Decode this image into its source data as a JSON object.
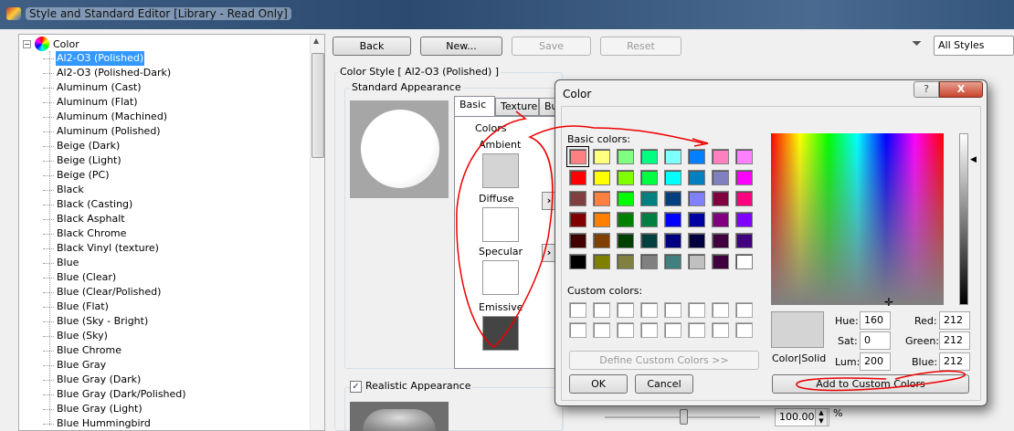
{
  "window": {
    "title": "Style and Standard Editor [Library - Read Only]"
  },
  "tree": {
    "root": "Color",
    "items": [
      "Al2-O3 (Polished)",
      "Al2-O3 (Polished-Dark)",
      "Aluminum (Cast)",
      "Aluminum (Flat)",
      "Aluminum (Machined)",
      "Aluminum (Polished)",
      "Beige (Dark)",
      "Beige (Light)",
      "Beige (PC)",
      "Black",
      "Black (Casting)",
      "Black Asphalt",
      "Black Chrome",
      "Black Vinyl (texture)",
      "Blue",
      "Blue (Clear)",
      "Blue (Clear/Polished)",
      "Blue (Flat)",
      "Blue (Sky - Bright)",
      "Blue (Sky)",
      "Blue Chrome",
      "Blue Gray",
      "Blue Gray (Dark)",
      "Blue Gray (Dark/Polished)",
      "Blue Gray (Light)",
      "Blue Hummingbird"
    ],
    "selected": 0
  },
  "toolbar": {
    "back": "Back",
    "new": "New...",
    "save": "Save",
    "reset": "Reset",
    "filter": "All Styles"
  },
  "style": {
    "header": "Color Style [ Al2-O3 (Polished) ]",
    "standard": "Standard Appearance",
    "tabs": [
      "Basic",
      "Texture",
      "Bu"
    ],
    "colors_label": "Colors",
    "ambient": "Ambient",
    "diffuse": "Diffuse",
    "specular": "Specular",
    "emissive": "Emissive",
    "ambient_color": "#d4d4d4",
    "diffuse_color": "#ffffff",
    "specular_color": "#ffffff",
    "emissive_color": "#444444",
    "realistic": "Realistic Appearance",
    "realistic_checked": true,
    "scale_value": "100.00",
    "scale_unit": "%"
  },
  "dialog": {
    "title": "Color",
    "help": "?",
    "close": "X",
    "basic_label": "Basic colors:",
    "custom_label": "Custom colors:",
    "define_custom": "Define Custom Colors >>",
    "ok": "OK",
    "cancel": "Cancel",
    "add_custom": "Add to Custom Colors",
    "color_solid": "Color|Solid",
    "hue_label": "Hue:",
    "sat_label": "Sat:",
    "lum_label": "Lum:",
    "red_label": "Red:",
    "green_label": "Green:",
    "blue_label": "Blue:",
    "hue": "160",
    "sat": "0",
    "lum": "200",
    "red": "212",
    "green": "212",
    "blue": "212",
    "basic_colors": [
      [
        "#FF8080",
        "#FFFF80",
        "#80FF80",
        "#00FF80",
        "#80FFFF",
        "#0080FF",
        "#FF80C0",
        "#FF80FF"
      ],
      [
        "#FF0000",
        "#FFFF00",
        "#80FF00",
        "#00FF40",
        "#00FFFF",
        "#0080C0",
        "#8080C0",
        "#FF00FF"
      ],
      [
        "#804040",
        "#FF8040",
        "#00FF00",
        "#008080",
        "#004080",
        "#8080FF",
        "#800040",
        "#FF0080"
      ],
      [
        "#800000",
        "#FF8000",
        "#008000",
        "#008040",
        "#0000FF",
        "#0000A0",
        "#800080",
        "#8000FF"
      ],
      [
        "#400000",
        "#804000",
        "#004000",
        "#004040",
        "#000080",
        "#000040",
        "#400040",
        "#400080"
      ],
      [
        "#000000",
        "#808000",
        "#808040",
        "#808080",
        "#408080",
        "#C0C0C0",
        "#400040",
        "#FFFFFF"
      ]
    ]
  }
}
